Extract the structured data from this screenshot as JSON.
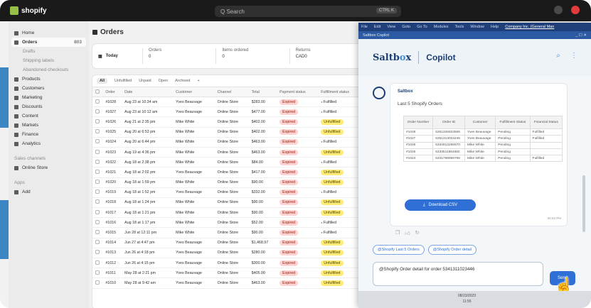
{
  "topbar": {
    "logo_text": "shopify",
    "search_placeholder": "Q Search",
    "search_shortcut": "CTRL K"
  },
  "sidebar": {
    "items": [
      {
        "label": "Home",
        "type": "main"
      },
      {
        "label": "Orders",
        "type": "active",
        "count": "803"
      },
      {
        "label": "Drafts",
        "type": "sub"
      },
      {
        "label": "Shipping labels",
        "type": "sub"
      },
      {
        "label": "Abandoned checkouts",
        "type": "sub"
      },
      {
        "label": "Products",
        "type": "main"
      },
      {
        "label": "Customers",
        "type": "main"
      },
      {
        "label": "Marketing",
        "type": "main"
      },
      {
        "label": "Discounts",
        "type": "main"
      },
      {
        "label": "Content",
        "type": "main"
      },
      {
        "label": "Markets",
        "type": "main"
      },
      {
        "label": "Finance",
        "type": "main"
      },
      {
        "label": "Analytics",
        "type": "main"
      }
    ],
    "section_channels": "Sales channels",
    "channel_item": "Online Store",
    "section_apps": "Apps",
    "apps_item": "Add"
  },
  "main": {
    "title": "Orders",
    "stats": [
      {
        "label": "Today",
        "value": ""
      },
      {
        "label": "Orders",
        "value": "0"
      },
      {
        "label": "Items ordered",
        "value": "0"
      },
      {
        "label": "Returns",
        "value": "CAD0"
      }
    ],
    "tabs": [
      "All",
      "Unfulfilled",
      "Unpaid",
      "Open",
      "Archived",
      "+"
    ],
    "columns": [
      "Order",
      "Date",
      "Customer",
      "Channel",
      "Total",
      "Payment status",
      "Fulfillment status"
    ],
    "rows": [
      {
        "order": "#1028",
        "date": "Aug 23 at 10:34 am",
        "customer": "Yves Beauvage",
        "channel": "Online Store",
        "total": "$283.00",
        "payment": "Expired",
        "fulfillment": "Fulfilled"
      },
      {
        "order": "#1027",
        "date": "Aug 23 at 10:12 am",
        "customer": "Yves Beauvage",
        "channel": "Online Store",
        "total": "$477.00",
        "payment": "Expired",
        "fulfillment": "Fulfilled"
      },
      {
        "order": "#1026",
        "date": "Aug 21 at 2:35 pm",
        "customer": "Mike White",
        "channel": "Online Store",
        "total": "$402.00",
        "payment": "Expired",
        "fulfillment": "Unfulfilled"
      },
      {
        "order": "#1025",
        "date": "Aug 20 at 6:53 pm",
        "customer": "Mike White",
        "channel": "Online Store",
        "total": "$402.00",
        "payment": "Expired",
        "fulfillment": "Unfulfilled"
      },
      {
        "order": "#1024",
        "date": "Aug 20 at 6:44 pm",
        "customer": "Mike White",
        "channel": "Online Store",
        "total": "$463.00",
        "payment": "Expired",
        "fulfillment": "Fulfilled"
      },
      {
        "order": "#1023",
        "date": "Aug 19 at 4:36 pm",
        "customer": "Mike White",
        "channel": "Online Store",
        "total": "$463.00",
        "payment": "Expired",
        "fulfillment": "Unfulfilled"
      },
      {
        "order": "#1022",
        "date": "Aug 18 at 2:38 pm",
        "customer": "Mike White",
        "channel": "Online Store",
        "total": "$84.00",
        "payment": "Expired",
        "fulfillment": "Fulfilled"
      },
      {
        "order": "#1021",
        "date": "Aug 18 at 2:02 pm",
        "customer": "Yves Beauvage",
        "channel": "Online Store",
        "total": "$417.00",
        "payment": "Expired",
        "fulfillment": "Unfulfilled"
      },
      {
        "order": "#1020",
        "date": "Aug 18 at 1:59 pm",
        "customer": "Mike White",
        "channel": "Online Store",
        "total": "$90.00",
        "payment": "Expired",
        "fulfillment": "Unfulfilled"
      },
      {
        "order": "#1019",
        "date": "Aug 18 at 1:52 pm",
        "customer": "Yves Beauvage",
        "channel": "Online Store",
        "total": "$332.00",
        "payment": "Expired",
        "fulfillment": "Fulfilled"
      },
      {
        "order": "#1018",
        "date": "Aug 18 at 1:24 pm",
        "customer": "Mike White",
        "channel": "Online Store",
        "total": "$90.00",
        "payment": "Expired",
        "fulfillment": "Unfulfilled"
      },
      {
        "order": "#1017",
        "date": "Aug 18 at 1:21 pm",
        "customer": "Mike White",
        "channel": "Online Store",
        "total": "$90.00",
        "payment": "Expired",
        "fulfillment": "Unfulfilled"
      },
      {
        "order": "#1016",
        "date": "Aug 18 at 1:17 pm",
        "customer": "Mike White",
        "channel": "Online Store",
        "total": "$52.00",
        "payment": "Expired",
        "fulfillment": "Fulfilled"
      },
      {
        "order": "#1015",
        "date": "Jun 28 at 12:11 pm",
        "customer": "Mike White",
        "channel": "Online Store",
        "total": "$90.00",
        "payment": "Expired",
        "fulfillment": "Fulfilled"
      },
      {
        "order": "#1014",
        "date": "Jun 27 at 4:47 pm",
        "customer": "Yves Beauvage",
        "channel": "Online Store",
        "total": "$1,468.97",
        "payment": "Expired",
        "fulfillment": "Unfulfilled"
      },
      {
        "order": "#1013",
        "date": "Jun 26 at 4:18 pm",
        "customer": "Yves Beauvage",
        "channel": "Online Store",
        "total": "$280.00",
        "payment": "Expired",
        "fulfillment": "Unfulfilled"
      },
      {
        "order": "#1012",
        "date": "Jun 26 at 4:15 pm",
        "customer": "Yves Beauvage",
        "channel": "Online Store",
        "total": "$300.00",
        "payment": "Expired",
        "fulfillment": "Unfulfilled"
      },
      {
        "order": "#1011",
        "date": "May 28 at 2:21 pm",
        "customer": "Yves Beauvage",
        "channel": "Online Store",
        "total": "$405.00",
        "payment": "Expired",
        "fulfillment": "Unfulfilled"
      },
      {
        "order": "#1010",
        "date": "May 28 at 9:42 am",
        "customer": "Yves Beauvage",
        "channel": "Online Store",
        "total": "$463.00",
        "payment": "Expired",
        "fulfillment": "Unfulfilled"
      }
    ]
  },
  "window": {
    "menu": [
      "File",
      "Edit",
      "View",
      "Goto",
      "Go To",
      "Modules",
      "Tools",
      "Window",
      "Help"
    ],
    "company": "Company Inc. (General Man",
    "title": "Saltbox Copilot",
    "controls": "_ ☐ ✕"
  },
  "copilot": {
    "brand_main": "Saltb",
    "brand_accent": "o",
    "brand_end": "x",
    "title": "Copilot",
    "sender": "Saltbox",
    "heading": "Last 5 Shopify Orders",
    "table_columns": [
      "Order Number",
      "Order ID",
      "Customer",
      "Fulfillment Status",
      "Financial Status"
    ],
    "table_rows": [
      [
        "#1028",
        "5351326823506",
        "Yves Beauvage",
        "Pending",
        "Fulfilled"
      ],
      [
        "#1027",
        "5351313023446",
        "Yves Beauvage",
        "Pending",
        "Fulfilled"
      ],
      [
        "#1026",
        "5334913255570",
        "Mike White",
        "Pending",
        ""
      ],
      [
        "#1025",
        "5333511864682",
        "Mike White",
        "Pending",
        ""
      ],
      [
        "#1024",
        "5331798959706",
        "Mike White",
        "Pending",
        "Fulfilled"
      ]
    ],
    "download_label": "Download CSV",
    "timestamp": "06:52 PM",
    "chips": [
      "@Shopify Last 5 Orders",
      "@Shopify Order detail"
    ],
    "input_value": "@Shopify Order detail for order 5341311023446",
    "send_label": "Send"
  },
  "taskbar": {
    "time": "11:55",
    "date": "08/23/2023"
  },
  "colors": {
    "shopify_dark": "#1a1a1a",
    "shopify_green": "#95bf47",
    "copilot_blue": "#2f6fd6",
    "brand_navy": "#1b3f73",
    "expired_bg": "#fed3d1",
    "unfulfilled_bg": "#ffeb78"
  },
  "icons": [
    "shopify-bag-icon",
    "search-icon",
    "notification-icon",
    "avatar-icon",
    "copilot-bot-icon",
    "download-icon",
    "thumbs-up-icon",
    "thumbs-down-icon",
    "copy-icon",
    "hand-cursor-icon"
  ]
}
